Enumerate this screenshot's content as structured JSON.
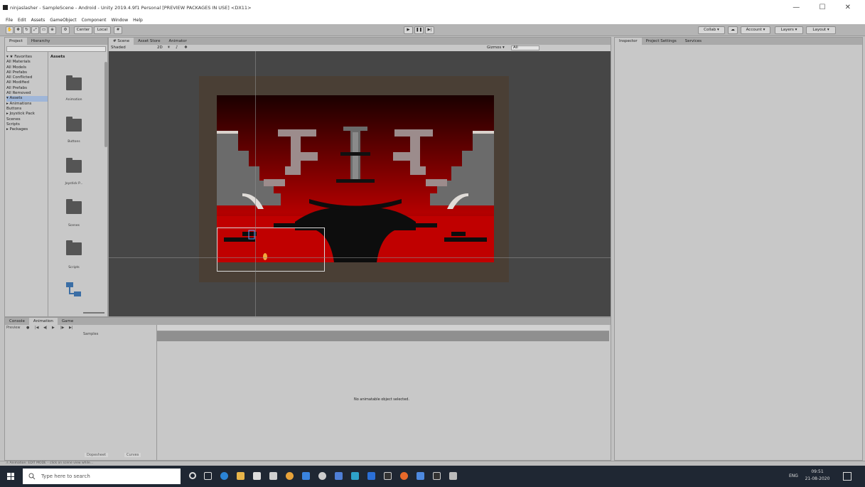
{
  "window": {
    "title": "ninjaslasher - SampleScene - Android - Unity 2019.4.9f1 Personal [PREVIEW PACKAGES IN USE] <DX11>",
    "controls": "— ☐ ✕"
  },
  "menu": [
    "File",
    "Edit",
    "Assets",
    "GameObject",
    "Component",
    "Window",
    "Help"
  ],
  "toolbar": {
    "center_label": "Center",
    "local_label": "Local",
    "collab_label": "Collab ▾",
    "account_label": "Account ▾",
    "layers_label": "Layers ▾",
    "layout_label": "Layout ▾"
  },
  "project_panel": {
    "tabs": [
      "Project",
      "Hierarchy"
    ],
    "tree": [
      "▾ ★ Favorites",
      "   All Materials",
      "   All Models",
      "   All Prefabs",
      "   All Conflicted",
      "   All Modified",
      "   All Prefabs",
      "   All Removed",
      "▾ Assets",
      "  ▸ Animations",
      "     Buttons",
      "  ▸ Joystick Pack",
      "     Scenes",
      "     Scripts",
      "▸ Packages"
    ],
    "assets_header": "Assets",
    "folders": [
      "Animation",
      "Buttons",
      "Joystick P...",
      "Scenes",
      "Scripts",
      ""
    ]
  },
  "scene_panel": {
    "tabs": [
      "# Scene",
      "Asset Store",
      "Animator"
    ],
    "shading_mode": "Shaded",
    "mode_2d": "2D",
    "gizmos": "Gizmos ▾",
    "search_placeholder": "All"
  },
  "inspector_panel": {
    "tabs": [
      "Inspector",
      "Project Settings",
      "Services"
    ]
  },
  "bottom_panel": {
    "tabs": [
      "Console",
      "Animation",
      "Game"
    ],
    "preview_label": "Preview",
    "samples_label": "Samples",
    "message": "No animatable object selected.",
    "dopesheet_label": "Dopesheet",
    "curves_label": "Curves"
  },
  "status_bar": {
    "text": "⚠ Animation: EDIT MODE – click on scene view while..."
  },
  "taskbar": {
    "search_placeholder": "Type here to search",
    "time": "09:51",
    "date": "21-08-2020",
    "lang": "ENG"
  }
}
